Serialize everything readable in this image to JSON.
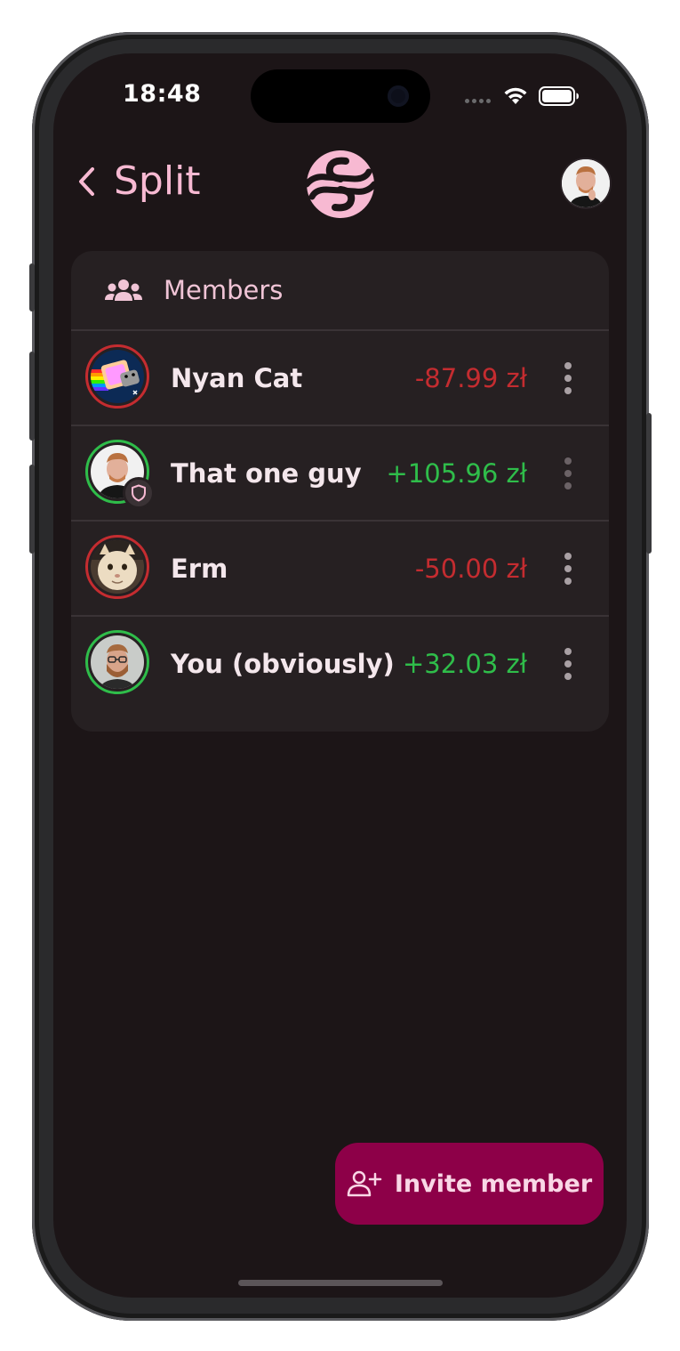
{
  "status_bar": {
    "time": "18:48"
  },
  "header": {
    "back_label": "Split"
  },
  "members_card": {
    "title": "Members",
    "members": [
      {
        "name": "Nyan Cat",
        "balance": "-87.99 zł",
        "status": "negative"
      },
      {
        "name": "That one guy",
        "balance": "+105.96 zł",
        "status": "positive",
        "admin": true
      },
      {
        "name": "Erm",
        "balance": "-50.00 zł",
        "status": "negative"
      },
      {
        "name": "You (obviously)",
        "balance": "+32.03 zł",
        "status": "positive"
      }
    ]
  },
  "invite_button": {
    "label": "Invite member"
  },
  "colors": {
    "accent_pink": "#f7b9d2",
    "negative": "#c42c30",
    "positive": "#2fbd4a",
    "invite_bg": "#8d0048",
    "background": "#1c1517",
    "card": "#262022"
  },
  "icons": [
    "chevron-left-icon",
    "app-logo-icon",
    "users-icon",
    "shield-icon",
    "more-vertical-icon",
    "user-plus-icon",
    "wifi-icon",
    "battery-icon"
  ]
}
